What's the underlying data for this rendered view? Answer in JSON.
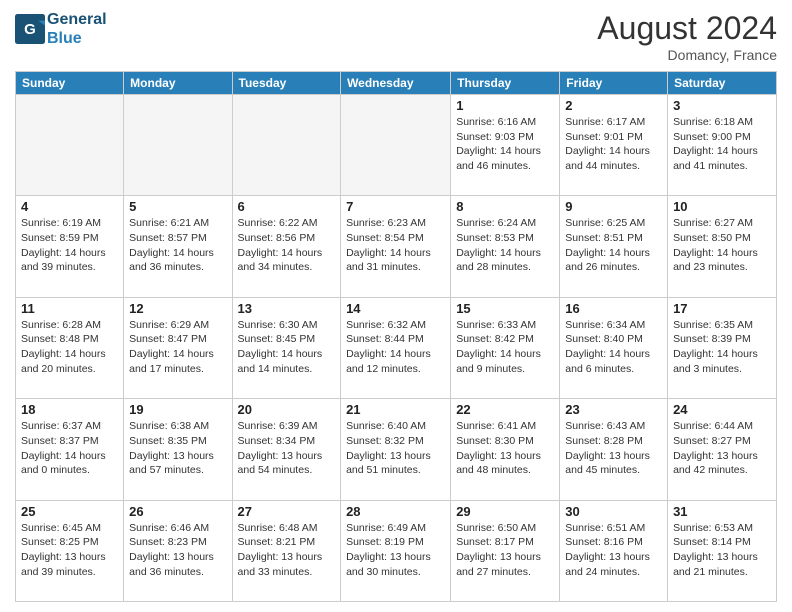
{
  "header": {
    "logo_line1": "General",
    "logo_line2": "Blue",
    "month_year": "August 2024",
    "location": "Domancy, France"
  },
  "days_of_week": [
    "Sunday",
    "Monday",
    "Tuesday",
    "Wednesday",
    "Thursday",
    "Friday",
    "Saturday"
  ],
  "weeks": [
    [
      {
        "day": "",
        "info": ""
      },
      {
        "day": "",
        "info": ""
      },
      {
        "day": "",
        "info": ""
      },
      {
        "day": "",
        "info": ""
      },
      {
        "day": "1",
        "info": "Sunrise: 6:16 AM\nSunset: 9:03 PM\nDaylight: 14 hours\nand 46 minutes."
      },
      {
        "day": "2",
        "info": "Sunrise: 6:17 AM\nSunset: 9:01 PM\nDaylight: 14 hours\nand 44 minutes."
      },
      {
        "day": "3",
        "info": "Sunrise: 6:18 AM\nSunset: 9:00 PM\nDaylight: 14 hours\nand 41 minutes."
      }
    ],
    [
      {
        "day": "4",
        "info": "Sunrise: 6:19 AM\nSunset: 8:59 PM\nDaylight: 14 hours\nand 39 minutes."
      },
      {
        "day": "5",
        "info": "Sunrise: 6:21 AM\nSunset: 8:57 PM\nDaylight: 14 hours\nand 36 minutes."
      },
      {
        "day": "6",
        "info": "Sunrise: 6:22 AM\nSunset: 8:56 PM\nDaylight: 14 hours\nand 34 minutes."
      },
      {
        "day": "7",
        "info": "Sunrise: 6:23 AM\nSunset: 8:54 PM\nDaylight: 14 hours\nand 31 minutes."
      },
      {
        "day": "8",
        "info": "Sunrise: 6:24 AM\nSunset: 8:53 PM\nDaylight: 14 hours\nand 28 minutes."
      },
      {
        "day": "9",
        "info": "Sunrise: 6:25 AM\nSunset: 8:51 PM\nDaylight: 14 hours\nand 26 minutes."
      },
      {
        "day": "10",
        "info": "Sunrise: 6:27 AM\nSunset: 8:50 PM\nDaylight: 14 hours\nand 23 minutes."
      }
    ],
    [
      {
        "day": "11",
        "info": "Sunrise: 6:28 AM\nSunset: 8:48 PM\nDaylight: 14 hours\nand 20 minutes."
      },
      {
        "day": "12",
        "info": "Sunrise: 6:29 AM\nSunset: 8:47 PM\nDaylight: 14 hours\nand 17 minutes."
      },
      {
        "day": "13",
        "info": "Sunrise: 6:30 AM\nSunset: 8:45 PM\nDaylight: 14 hours\nand 14 minutes."
      },
      {
        "day": "14",
        "info": "Sunrise: 6:32 AM\nSunset: 8:44 PM\nDaylight: 14 hours\nand 12 minutes."
      },
      {
        "day": "15",
        "info": "Sunrise: 6:33 AM\nSunset: 8:42 PM\nDaylight: 14 hours\nand 9 minutes."
      },
      {
        "day": "16",
        "info": "Sunrise: 6:34 AM\nSunset: 8:40 PM\nDaylight: 14 hours\nand 6 minutes."
      },
      {
        "day": "17",
        "info": "Sunrise: 6:35 AM\nSunset: 8:39 PM\nDaylight: 14 hours\nand 3 minutes."
      }
    ],
    [
      {
        "day": "18",
        "info": "Sunrise: 6:37 AM\nSunset: 8:37 PM\nDaylight: 14 hours\nand 0 minutes."
      },
      {
        "day": "19",
        "info": "Sunrise: 6:38 AM\nSunset: 8:35 PM\nDaylight: 13 hours\nand 57 minutes."
      },
      {
        "day": "20",
        "info": "Sunrise: 6:39 AM\nSunset: 8:34 PM\nDaylight: 13 hours\nand 54 minutes."
      },
      {
        "day": "21",
        "info": "Sunrise: 6:40 AM\nSunset: 8:32 PM\nDaylight: 13 hours\nand 51 minutes."
      },
      {
        "day": "22",
        "info": "Sunrise: 6:41 AM\nSunset: 8:30 PM\nDaylight: 13 hours\nand 48 minutes."
      },
      {
        "day": "23",
        "info": "Sunrise: 6:43 AM\nSunset: 8:28 PM\nDaylight: 13 hours\nand 45 minutes."
      },
      {
        "day": "24",
        "info": "Sunrise: 6:44 AM\nSunset: 8:27 PM\nDaylight: 13 hours\nand 42 minutes."
      }
    ],
    [
      {
        "day": "25",
        "info": "Sunrise: 6:45 AM\nSunset: 8:25 PM\nDaylight: 13 hours\nand 39 minutes."
      },
      {
        "day": "26",
        "info": "Sunrise: 6:46 AM\nSunset: 8:23 PM\nDaylight: 13 hours\nand 36 minutes."
      },
      {
        "day": "27",
        "info": "Sunrise: 6:48 AM\nSunset: 8:21 PM\nDaylight: 13 hours\nand 33 minutes."
      },
      {
        "day": "28",
        "info": "Sunrise: 6:49 AM\nSunset: 8:19 PM\nDaylight: 13 hours\nand 30 minutes."
      },
      {
        "day": "29",
        "info": "Sunrise: 6:50 AM\nSunset: 8:17 PM\nDaylight: 13 hours\nand 27 minutes."
      },
      {
        "day": "30",
        "info": "Sunrise: 6:51 AM\nSunset: 8:16 PM\nDaylight: 13 hours\nand 24 minutes."
      },
      {
        "day": "31",
        "info": "Sunrise: 6:53 AM\nSunset: 8:14 PM\nDaylight: 13 hours\nand 21 minutes."
      }
    ]
  ]
}
